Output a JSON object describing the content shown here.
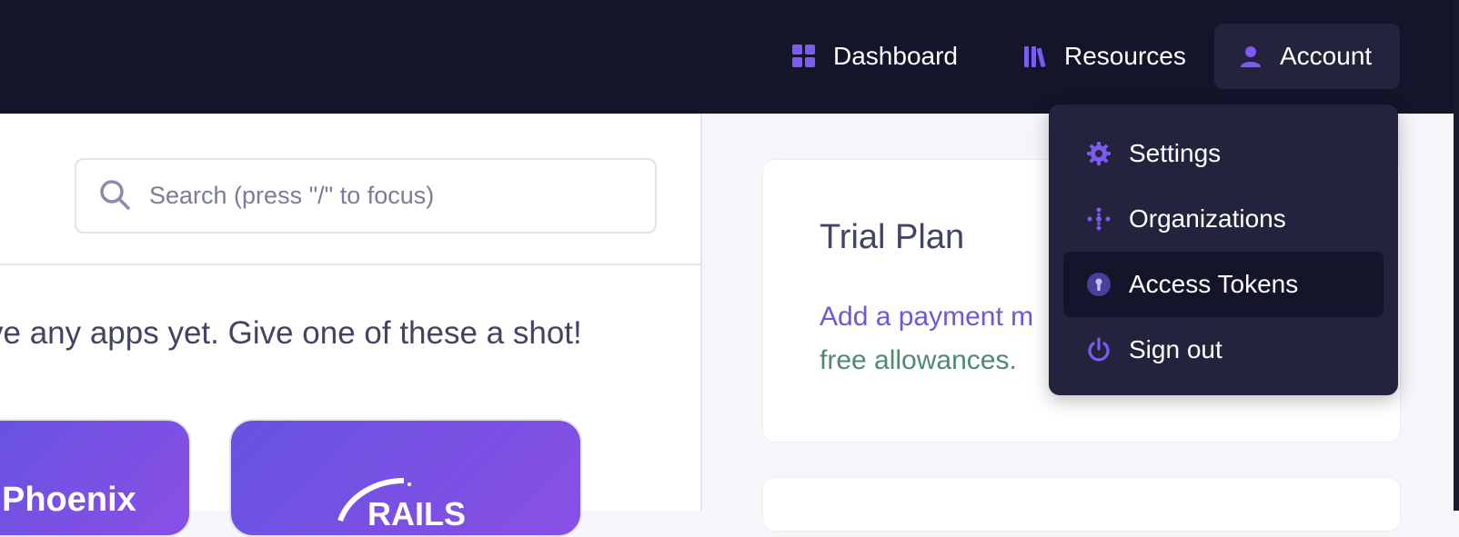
{
  "nav": {
    "dashboard_label": "Dashboard",
    "resources_label": "Resources",
    "account_label": "Account"
  },
  "account_menu": {
    "items": [
      {
        "label": "Settings",
        "icon": "gear-icon"
      },
      {
        "label": "Organizations",
        "icon": "organizations-icon"
      },
      {
        "label": "Access Tokens",
        "icon": "keyhole-icon"
      },
      {
        "label": "Sign out",
        "icon": "power-icon"
      }
    ]
  },
  "search": {
    "placeholder": "Search (press \"/\" to focus)"
  },
  "main": {
    "empty_message": "ve any apps yet. Give one of these a shot!",
    "tiles": [
      {
        "label": "Phoenix"
      },
      {
        "label": "RAILS"
      }
    ]
  },
  "trial_card": {
    "title": "Trial Plan",
    "link_text": "Add a payment m",
    "sub_text": "free allowances."
  },
  "colors": {
    "topbar": "#14142b",
    "accent": "#7c5cf0",
    "menu_bg": "#23233d",
    "link": "#6b5ad8",
    "success": "#4f8a6e"
  }
}
